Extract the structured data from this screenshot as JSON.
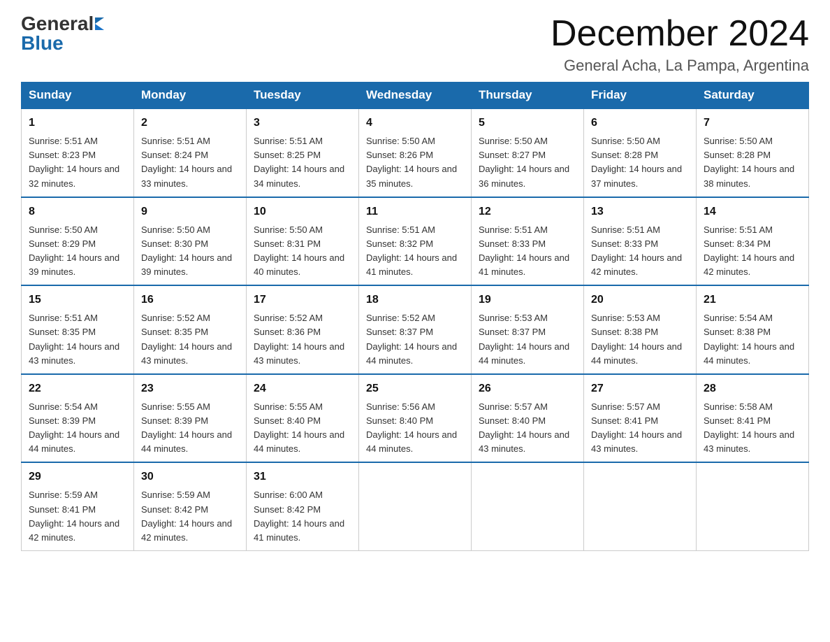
{
  "header": {
    "logo_general": "General",
    "logo_blue": "Blue",
    "title": "December 2024",
    "subtitle": "General Acha, La Pampa, Argentina"
  },
  "calendar": {
    "days_of_week": [
      "Sunday",
      "Monday",
      "Tuesday",
      "Wednesday",
      "Thursday",
      "Friday",
      "Saturday"
    ],
    "weeks": [
      [
        {
          "day": "1",
          "sunrise": "5:51 AM",
          "sunset": "8:23 PM",
          "daylight": "14 hours and 32 minutes."
        },
        {
          "day": "2",
          "sunrise": "5:51 AM",
          "sunset": "8:24 PM",
          "daylight": "14 hours and 33 minutes."
        },
        {
          "day": "3",
          "sunrise": "5:51 AM",
          "sunset": "8:25 PM",
          "daylight": "14 hours and 34 minutes."
        },
        {
          "day": "4",
          "sunrise": "5:50 AM",
          "sunset": "8:26 PM",
          "daylight": "14 hours and 35 minutes."
        },
        {
          "day": "5",
          "sunrise": "5:50 AM",
          "sunset": "8:27 PM",
          "daylight": "14 hours and 36 minutes."
        },
        {
          "day": "6",
          "sunrise": "5:50 AM",
          "sunset": "8:28 PM",
          "daylight": "14 hours and 37 minutes."
        },
        {
          "day": "7",
          "sunrise": "5:50 AM",
          "sunset": "8:28 PM",
          "daylight": "14 hours and 38 minutes."
        }
      ],
      [
        {
          "day": "8",
          "sunrise": "5:50 AM",
          "sunset": "8:29 PM",
          "daylight": "14 hours and 39 minutes."
        },
        {
          "day": "9",
          "sunrise": "5:50 AM",
          "sunset": "8:30 PM",
          "daylight": "14 hours and 39 minutes."
        },
        {
          "day": "10",
          "sunrise": "5:50 AM",
          "sunset": "8:31 PM",
          "daylight": "14 hours and 40 minutes."
        },
        {
          "day": "11",
          "sunrise": "5:51 AM",
          "sunset": "8:32 PM",
          "daylight": "14 hours and 41 minutes."
        },
        {
          "day": "12",
          "sunrise": "5:51 AM",
          "sunset": "8:33 PM",
          "daylight": "14 hours and 41 minutes."
        },
        {
          "day": "13",
          "sunrise": "5:51 AM",
          "sunset": "8:33 PM",
          "daylight": "14 hours and 42 minutes."
        },
        {
          "day": "14",
          "sunrise": "5:51 AM",
          "sunset": "8:34 PM",
          "daylight": "14 hours and 42 minutes."
        }
      ],
      [
        {
          "day": "15",
          "sunrise": "5:51 AM",
          "sunset": "8:35 PM",
          "daylight": "14 hours and 43 minutes."
        },
        {
          "day": "16",
          "sunrise": "5:52 AM",
          "sunset": "8:35 PM",
          "daylight": "14 hours and 43 minutes."
        },
        {
          "day": "17",
          "sunrise": "5:52 AM",
          "sunset": "8:36 PM",
          "daylight": "14 hours and 43 minutes."
        },
        {
          "day": "18",
          "sunrise": "5:52 AM",
          "sunset": "8:37 PM",
          "daylight": "14 hours and 44 minutes."
        },
        {
          "day": "19",
          "sunrise": "5:53 AM",
          "sunset": "8:37 PM",
          "daylight": "14 hours and 44 minutes."
        },
        {
          "day": "20",
          "sunrise": "5:53 AM",
          "sunset": "8:38 PM",
          "daylight": "14 hours and 44 minutes."
        },
        {
          "day": "21",
          "sunrise": "5:54 AM",
          "sunset": "8:38 PM",
          "daylight": "14 hours and 44 minutes."
        }
      ],
      [
        {
          "day": "22",
          "sunrise": "5:54 AM",
          "sunset": "8:39 PM",
          "daylight": "14 hours and 44 minutes."
        },
        {
          "day": "23",
          "sunrise": "5:55 AM",
          "sunset": "8:39 PM",
          "daylight": "14 hours and 44 minutes."
        },
        {
          "day": "24",
          "sunrise": "5:55 AM",
          "sunset": "8:40 PM",
          "daylight": "14 hours and 44 minutes."
        },
        {
          "day": "25",
          "sunrise": "5:56 AM",
          "sunset": "8:40 PM",
          "daylight": "14 hours and 44 minutes."
        },
        {
          "day": "26",
          "sunrise": "5:57 AM",
          "sunset": "8:40 PM",
          "daylight": "14 hours and 43 minutes."
        },
        {
          "day": "27",
          "sunrise": "5:57 AM",
          "sunset": "8:41 PM",
          "daylight": "14 hours and 43 minutes."
        },
        {
          "day": "28",
          "sunrise": "5:58 AM",
          "sunset": "8:41 PM",
          "daylight": "14 hours and 43 minutes."
        }
      ],
      [
        {
          "day": "29",
          "sunrise": "5:59 AM",
          "sunset": "8:41 PM",
          "daylight": "14 hours and 42 minutes."
        },
        {
          "day": "30",
          "sunrise": "5:59 AM",
          "sunset": "8:42 PM",
          "daylight": "14 hours and 42 minutes."
        },
        {
          "day": "31",
          "sunrise": "6:00 AM",
          "sunset": "8:42 PM",
          "daylight": "14 hours and 41 minutes."
        },
        null,
        null,
        null,
        null
      ]
    ]
  }
}
